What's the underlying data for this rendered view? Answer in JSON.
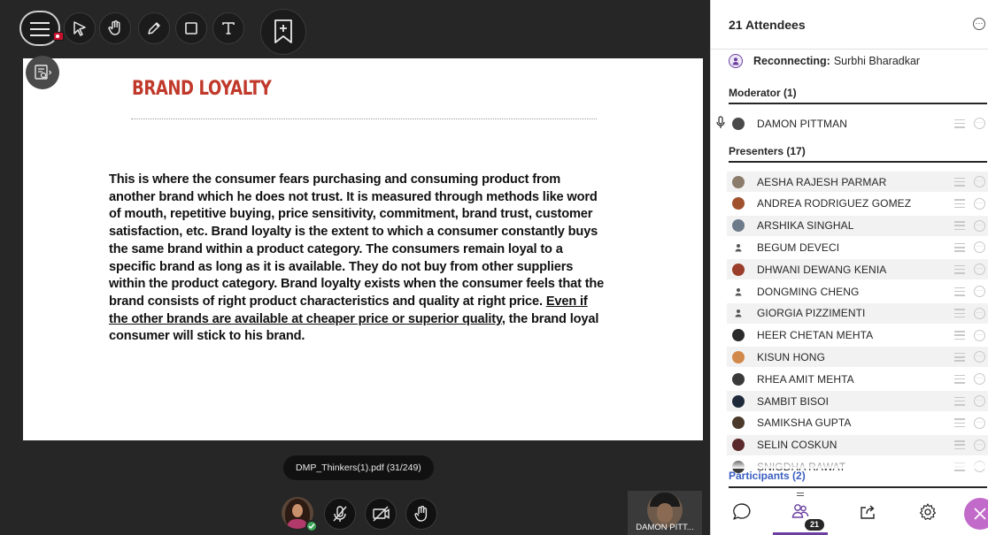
{
  "slide": {
    "title": "BRAND LOYALTY",
    "body_main": "This is where the consumer fears purchasing and consuming product from another brand which he does not trust. It is measured through methods like word of mouth, repetitive buying, price sensitivity, commitment, brand trust, customer satisfaction, etc. Brand loyalty is the extent to which a consumer constantly buys the same brand within a product category. The consumers remain loyal to a specific brand as long as it is available. They do not buy from other suppliers within the product category. Brand loyalty exists when the consumer feels that the brand consists of right product characteristics and quality at right price. ",
    "body_underlined": "Even if the other brands are available at cheaper price or superior quality",
    "body_end": ", the brand loyal consumer will stick to his brand."
  },
  "file_label": "DMP_Thinkers(1).pdf  (31/249)",
  "video_tile": {
    "name": "DAMON PITT..."
  },
  "toolbar": {
    "icons": [
      "menu-icon",
      "pointer-icon",
      "hand-icon",
      "pen-icon",
      "shape-icon",
      "text-icon",
      "bookmark-add-icon"
    ]
  },
  "panel": {
    "title": "21 Attendees",
    "reconnecting_label": "Reconnecting:",
    "reconnecting_name": "Surbhi Bharadkar",
    "moderator_header": "Moderator (1)",
    "moderator_name": "DAMON PITTMAN",
    "presenters_header": "Presenters (17)",
    "presenters": [
      "AESHA RAJESH PARMAR",
      "ANDREA RODRIGUEZ GOMEZ",
      "ARSHIKA SINGHAL",
      "BEGUM DEVECI",
      "DHWANI DEWANG KENIA",
      "DONGMING CHENG",
      "GIORGIA PIZZIMENTI",
      "HEER CHETAN MEHTA",
      "KISUN HONG",
      "RHEA AMIT MEHTA",
      "SAMBIT BISOI",
      "SAMIKSHA GUPTA",
      "SELIN COSKUN",
      "SNIGDHA RAWAT"
    ],
    "participants_header": "Participants (2)",
    "attendee_badge": "21"
  },
  "colors": {
    "slide_title": "#c0392b",
    "accent": "#6b3fa0",
    "link": "#3b5fc0",
    "close_button": "#c16ac9",
    "status_ok": "#3aa757",
    "recording": "#c8102e"
  }
}
